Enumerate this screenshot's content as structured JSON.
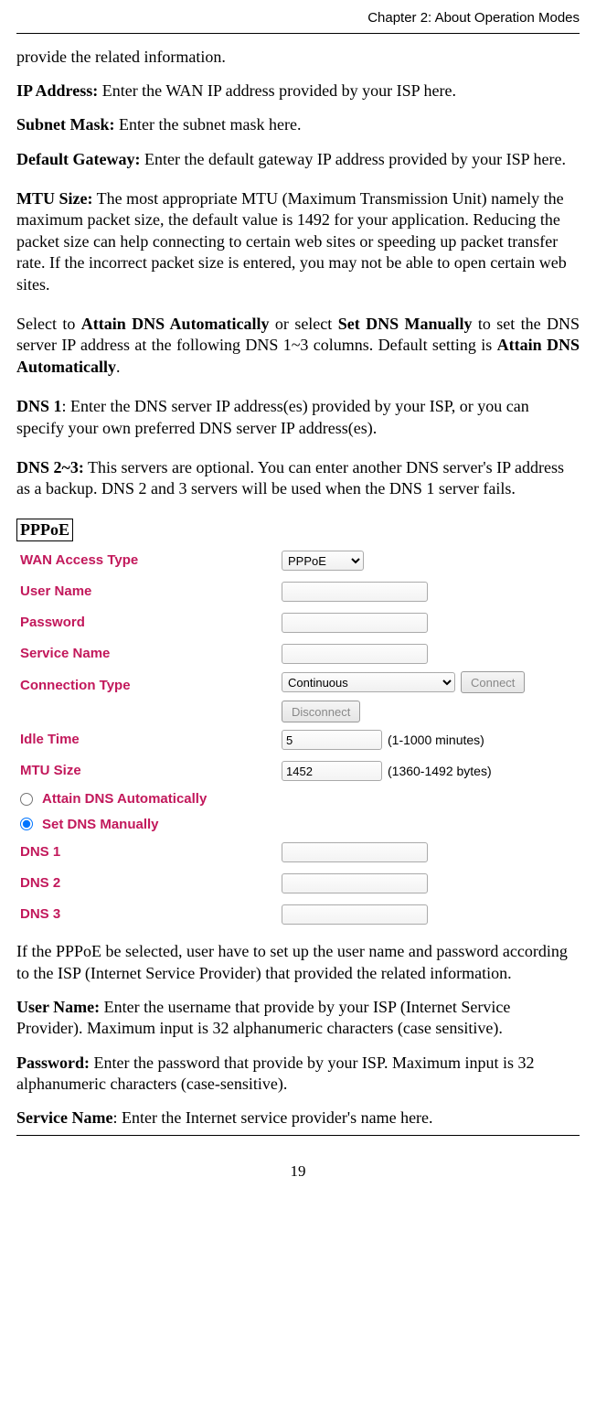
{
  "header": {
    "chapter": "Chapter 2: About Operation Modes"
  },
  "intro": {
    "line0": "provide the related information."
  },
  "fields": {
    "ip": {
      "label": "IP Address:",
      "text": " Enter the WAN IP address provided by your ISP here."
    },
    "subnet": {
      "label": "Subnet Mask:",
      "text": " Enter the subnet mask here."
    },
    "gateway": {
      "label": "Default Gateway:",
      "text": " Enter the default gateway IP address provided by your ISP here."
    },
    "mtu": {
      "label": "MTU Size:",
      "text": " The most appropriate MTU (Maximum Transmission Unit) namely the maximum packet size, the default value is 1492 for your application. Reducing the packet size can help connecting to certain web sites or speeding up packet transfer rate. If the incorrect packet size is entered, you may not be able to open certain web sites."
    },
    "dnsSelect": {
      "pre": "Select to ",
      "b1": "Attain DNS Automatically",
      "mid": " or select ",
      "b2": "Set DNS Manually",
      "post1": " to set the DNS server IP address at the following DNS 1~3 columns. Default setting is ",
      "b3": "Attain DNS Automatically",
      "post2": "."
    },
    "dns1": {
      "label": "DNS 1",
      "text": ": Enter the DNS server IP address(es) provided by your ISP, or you can specify your own preferred DNS server IP address(es)."
    },
    "dns23": {
      "label": "DNS 2~3:",
      "text": " This servers are optional. You can enter another DNS server's IP address as a backup. DNS 2 and 3 servers will be used when the DNS 1 server fails."
    },
    "user": {
      "label": "User Name:",
      "text": " Enter the username that provide by your ISP (Internet Service Provider). Maximum input is 32 alphanumeric characters (case sensitive)."
    },
    "pass": {
      "label": "Password:",
      "text": " Enter the password that provide by your ISP. Maximum input is 32 alphanumeric characters (case-sensitive)."
    },
    "svc": {
      "label": "Service Name",
      "text": ": Enter the Internet service provider's name here."
    }
  },
  "pppoe": {
    "sectionTitle": "PPPoE",
    "labels": {
      "wan": "WAN Access Type",
      "user": "User Name",
      "pass": "Password",
      "svc": "Service Name",
      "conn": "Connection Type",
      "idle": "Idle Time",
      "mtu": "MTU Size",
      "attain": "Attain DNS Automatically",
      "manual": "Set DNS Manually",
      "dns1": "DNS 1",
      "dns2": "DNS 2",
      "dns3": "DNS 3"
    },
    "values": {
      "wanAccess": "PPPoE",
      "connType": "Continuous",
      "idle": "5",
      "mtu": "1452"
    },
    "hints": {
      "idle": "(1-1000 minutes)",
      "mtu": "(1360-1492 bytes)"
    },
    "buttons": {
      "connect": "Connect",
      "disconnect": "Disconnect"
    },
    "afterText": "If the PPPoE be selected, user have to set up the user name and password according to the ISP (Internet Service Provider) that provided the related information."
  },
  "page": {
    "number": "19"
  }
}
